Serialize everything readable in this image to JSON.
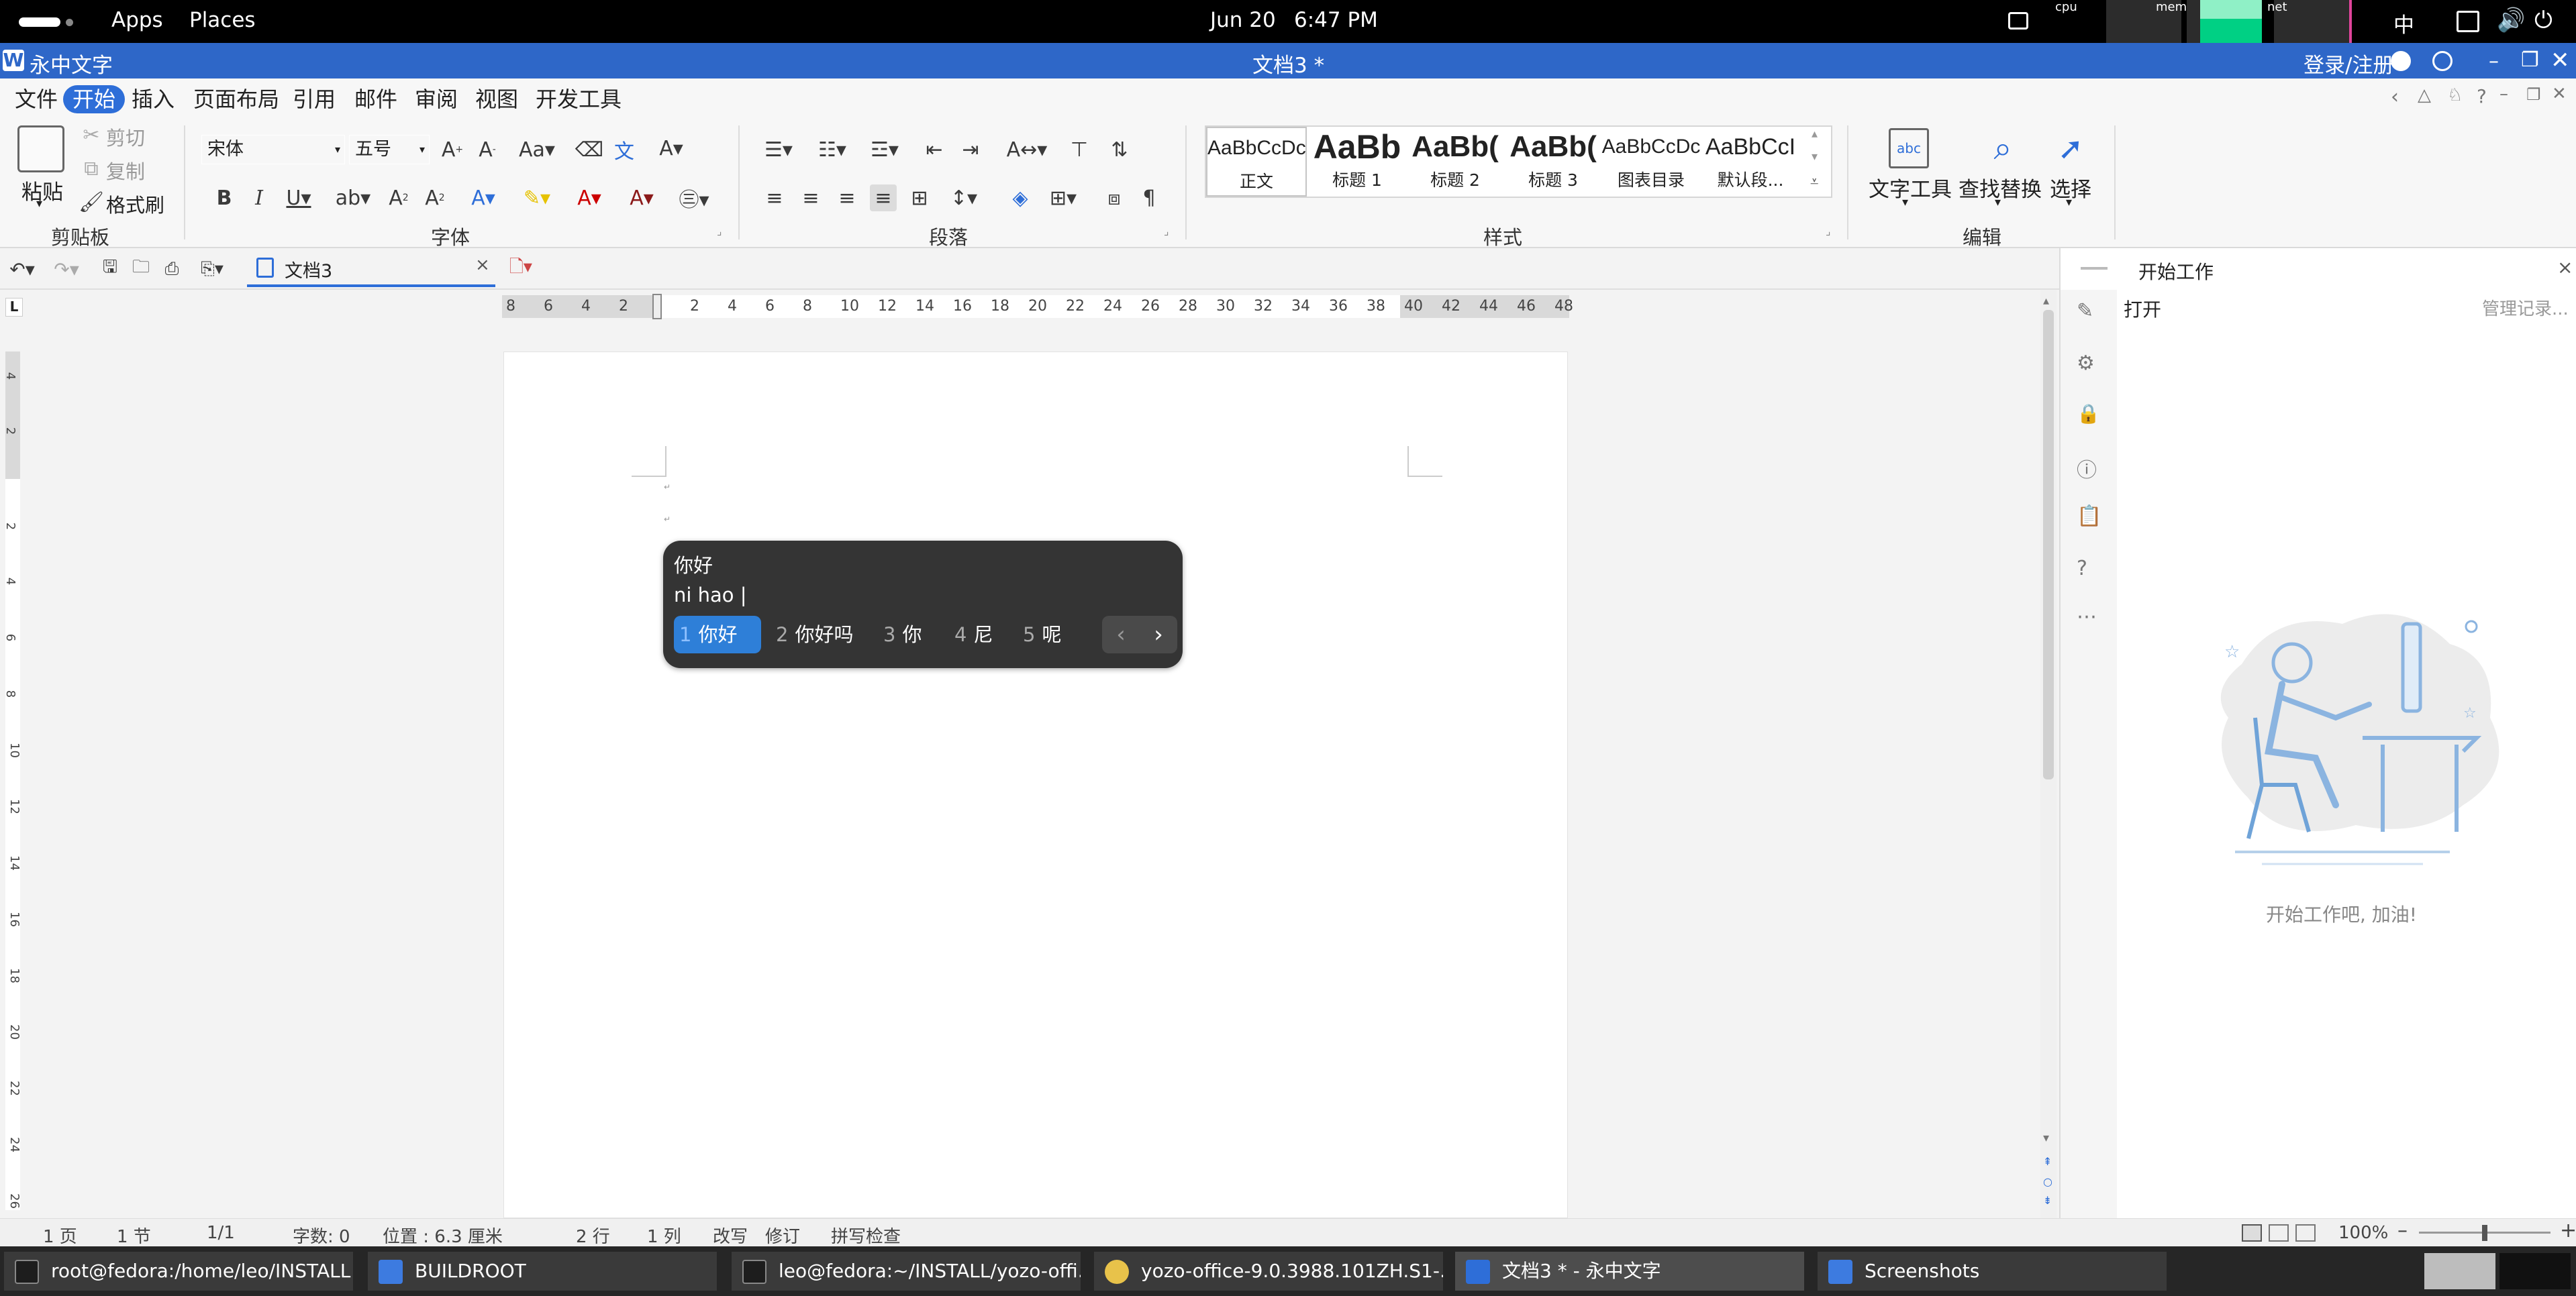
{
  "topbar": {
    "apps": "Apps",
    "places": "Places",
    "date": "Jun 20",
    "time": "6:47 PM",
    "monitors": [
      "cpu",
      "mem",
      "net"
    ],
    "input_method": "中"
  },
  "window": {
    "app_name": "永中文字",
    "doc_title": "文档3 *",
    "login": "登录/注册"
  },
  "menu": {
    "items": [
      "文件",
      "开始",
      "插入",
      "页面布局",
      "引用",
      "邮件",
      "审阅",
      "视图",
      "开发工具"
    ],
    "active": "开始"
  },
  "ribbon": {
    "clipboard": {
      "paste": "粘贴",
      "cut": "剪切",
      "copy": "复制",
      "format_painter": "格式刷",
      "label": "剪贴板"
    },
    "font": {
      "name": "宋体",
      "size": "五号",
      "label": "字体"
    },
    "paragraph": {
      "label": "段落"
    },
    "styles": {
      "label": "样式",
      "items": [
        {
          "preview": "AaBbCcDc",
          "name": "正文"
        },
        {
          "preview": "AaBb",
          "name": "标题 1"
        },
        {
          "preview": "AaBb(",
          "name": "标题 2"
        },
        {
          "preview": "AaBb(",
          "name": "标题 3"
        },
        {
          "preview": "AaBbCcDc",
          "name": "图表目录"
        },
        {
          "preview": "AaBbCcI",
          "name": "默认段..."
        }
      ]
    },
    "editing": {
      "text_tools": "文字工具",
      "find_replace": "查找替换",
      "select": "选择",
      "label": "编辑"
    }
  },
  "tabs": {
    "doc_tab": "文档3"
  },
  "ruler": {
    "h_ticks": [
      "8",
      "6",
      "4",
      "2",
      "2",
      "4",
      "6",
      "8",
      "10",
      "12",
      "14",
      "16",
      "18",
      "20",
      "22",
      "24",
      "26",
      "28",
      "30",
      "32",
      "34",
      "36",
      "38",
      "40",
      "42",
      "44",
      "46",
      "48"
    ],
    "v_ticks": [
      "4",
      "2",
      "2",
      "4",
      "6",
      "8",
      "10",
      "12",
      "14",
      "16",
      "18",
      "20",
      "22",
      "24",
      "26"
    ],
    "corner": "L"
  },
  "ime": {
    "preedit": "你好",
    "pinyin": "ni hao |",
    "candidates": [
      {
        "num": "1",
        "text": "你好"
      },
      {
        "num": "2",
        "text": "你好吗"
      },
      {
        "num": "3",
        "text": "你"
      },
      {
        "num": "4",
        "text": "尼"
      },
      {
        "num": "5",
        "text": "呢"
      }
    ]
  },
  "right_panel": {
    "title": "开始工作",
    "open": "打开",
    "manage": "管理记录...",
    "slogan": "开始工作吧, 加油!"
  },
  "status": {
    "page": "1 页",
    "section": "1 节",
    "pages": "1/1",
    "words": "字数: 0",
    "position": "位置 : 6.3 厘米",
    "row": "2 行",
    "col": "1 列",
    "overwrite": "改写",
    "track": "修订",
    "spell": "拼写检查",
    "zoom": "100%"
  },
  "taskbar": {
    "items": [
      "root@fedora:/home/leo/INSTALL",
      "BUILDROOT",
      "leo@fedora:~/INSTALL/yozo-offi...",
      "yozo-office-9.0.3988.101ZH.S1-...",
      "文档3 * - 永中文字",
      "Screenshots"
    ]
  },
  "colors": {
    "accent": "#2e6ed8",
    "titlebar": "#2e67c8",
    "ime_bg": "#343434"
  }
}
